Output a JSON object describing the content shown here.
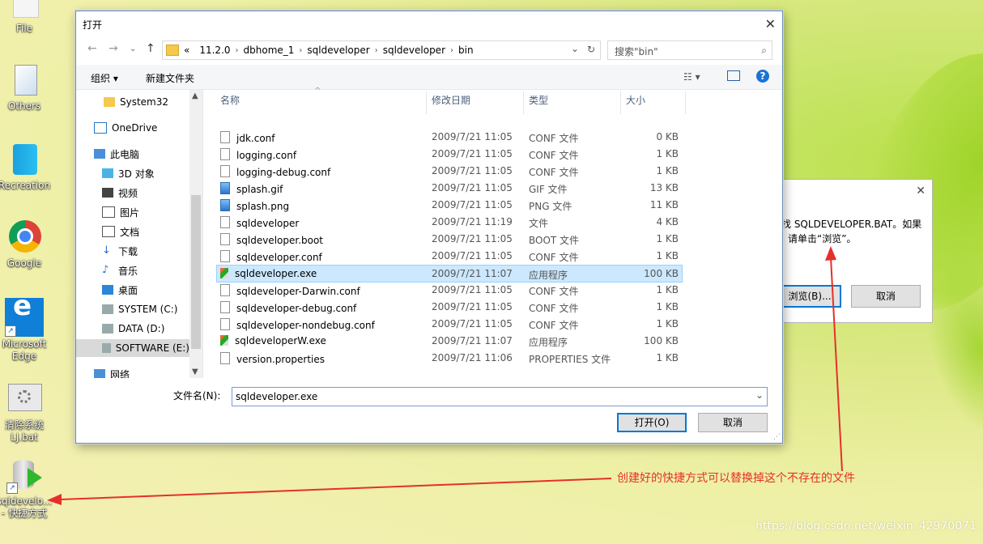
{
  "desktop": {
    "icons": [
      {
        "label": "File"
      },
      {
        "label": "Others"
      },
      {
        "label": "Recreation"
      },
      {
        "label": "Google"
      },
      {
        "label": "Microsoft\nEdge"
      },
      {
        "label": "清除系统\nLJ.bat"
      },
      {
        "label": "sqldevelo...\n- 快捷方式"
      }
    ]
  },
  "dialog": {
    "title": "打开",
    "close_glyph": "✕",
    "nav": {
      "back": "←",
      "forward": "→",
      "up": "↑"
    },
    "address": {
      "prefix": "«",
      "crumbs": [
        "11.2.0",
        "dbhome_1",
        "sqldeveloper",
        "sqldeveloper",
        "bin"
      ]
    },
    "search": {
      "placeholder": "搜索\"bin\""
    },
    "toolbar": {
      "organize": "组织 ▾",
      "new_folder": "新建文件夹",
      "help": "?"
    },
    "nav_pane": {
      "items": [
        "System32",
        "OneDrive",
        "此电脑",
        "3D 对象",
        "视频",
        "图片",
        "文档",
        "下载",
        "音乐",
        "桌面",
        "SYSTEM (C:)",
        "DATA (D:)",
        "SOFTWARE (E:)",
        "网络"
      ]
    },
    "columns": {
      "name": "名称",
      "date": "修改日期",
      "type": "类型",
      "size": "大小"
    },
    "files": [
      {
        "name": "jdk.conf",
        "date": "2009/7/21 11:05",
        "type": "CONF 文件",
        "size": "0 KB"
      },
      {
        "name": "logging.conf",
        "date": "2009/7/21 11:05",
        "type": "CONF 文件",
        "size": "1 KB"
      },
      {
        "name": "logging-debug.conf",
        "date": "2009/7/21 11:05",
        "type": "CONF 文件",
        "size": "1 KB"
      },
      {
        "name": "splash.gif",
        "date": "2009/7/21 11:05",
        "type": "GIF 文件",
        "size": "13 KB"
      },
      {
        "name": "splash.png",
        "date": "2009/7/21 11:05",
        "type": "PNG 文件",
        "size": "11 KB"
      },
      {
        "name": "sqldeveloper",
        "date": "2009/7/21 11:19",
        "type": "文件",
        "size": "4 KB"
      },
      {
        "name": "sqldeveloper.boot",
        "date": "2009/7/21 11:05",
        "type": "BOOT 文件",
        "size": "1 KB"
      },
      {
        "name": "sqldeveloper.conf",
        "date": "2009/7/21 11:05",
        "type": "CONF 文件",
        "size": "1 KB"
      },
      {
        "name": "sqldeveloper.exe",
        "date": "2009/7/21 11:07",
        "type": "应用程序",
        "size": "100 KB"
      },
      {
        "name": "sqldeveloper-Darwin.conf",
        "date": "2009/7/21 11:05",
        "type": "CONF 文件",
        "size": "1 KB"
      },
      {
        "name": "sqldeveloper-debug.conf",
        "date": "2009/7/21 11:05",
        "type": "CONF 文件",
        "size": "1 KB"
      },
      {
        "name": "sqldeveloper-nondebug.conf",
        "date": "2009/7/21 11:05",
        "type": "CONF 文件",
        "size": "1 KB"
      },
      {
        "name": "sqldeveloperW.exe",
        "date": "2009/7/21 11:07",
        "type": "应用程序",
        "size": "100 KB"
      },
      {
        "name": "version.properties",
        "date": "2009/7/21 11:06",
        "type": "PROPERTIES 文件",
        "size": "1 KB"
      }
    ],
    "filename_label": "文件名(N):",
    "filename_value": "sqldeveloper.exe",
    "open_button": "打开(O)",
    "cancel_button": "取消"
  },
  "behind_dialog": {
    "message_line1": "找 SQLDEVELOPER.BAT。如果",
    "message_line2": "请单击“浏览”。",
    "browse_button": "浏览(B)...",
    "cancel_button": "取消",
    "close_glyph": "✕"
  },
  "annotation": "创建好的快捷方式可以替换掉这个不存在的文件",
  "watermark": "https://blog.csdn.net/weixin_42970071",
  "colors": {
    "annotation_red": "#e5302a",
    "selection": "#cce8ff",
    "accent": "#0078d7"
  }
}
